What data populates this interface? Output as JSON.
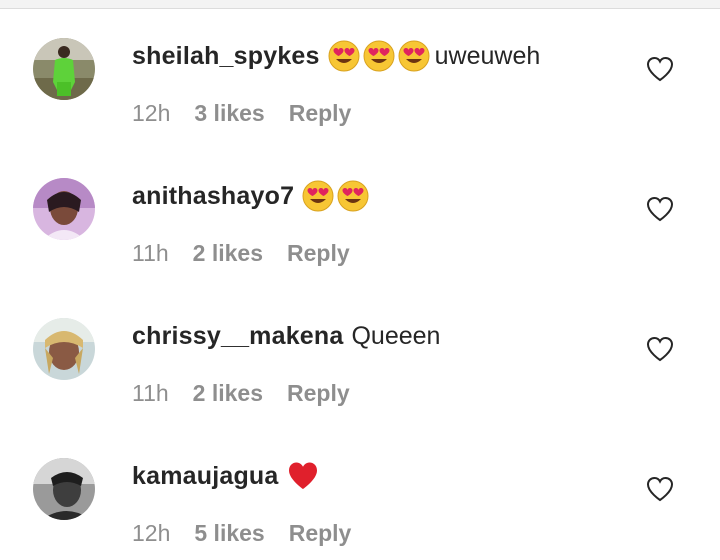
{
  "comments": [
    {
      "username": "sheilah_spykes",
      "text": "",
      "emojis": [
        "heart-eyes",
        "heart-eyes",
        "heart-eyes"
      ],
      "trailing_text": "uweuweh",
      "time": "12h",
      "likes": "3 likes",
      "reply": "Reply"
    },
    {
      "username": "anithashayo7",
      "text": "",
      "emojis": [
        "heart-eyes",
        "heart-eyes"
      ],
      "trailing_text": "",
      "time": "11h",
      "likes": "2 likes",
      "reply": "Reply"
    },
    {
      "username": "chrissy__makena",
      "text": "Queeen",
      "emojis": [],
      "trailing_text": "",
      "time": "11h",
      "likes": "2 likes",
      "reply": "Reply"
    },
    {
      "username": "kamaujagua",
      "text": "",
      "emojis": [
        "red-heart"
      ],
      "trailing_text": "",
      "time": "12h",
      "likes": "5 likes",
      "reply": "Reply"
    }
  ],
  "colors": {
    "primary_text": "#262626",
    "secondary_text": "#8e8e8e",
    "heart_red": "#e0202c"
  },
  "icons": {
    "like": "heart-outline-icon"
  }
}
